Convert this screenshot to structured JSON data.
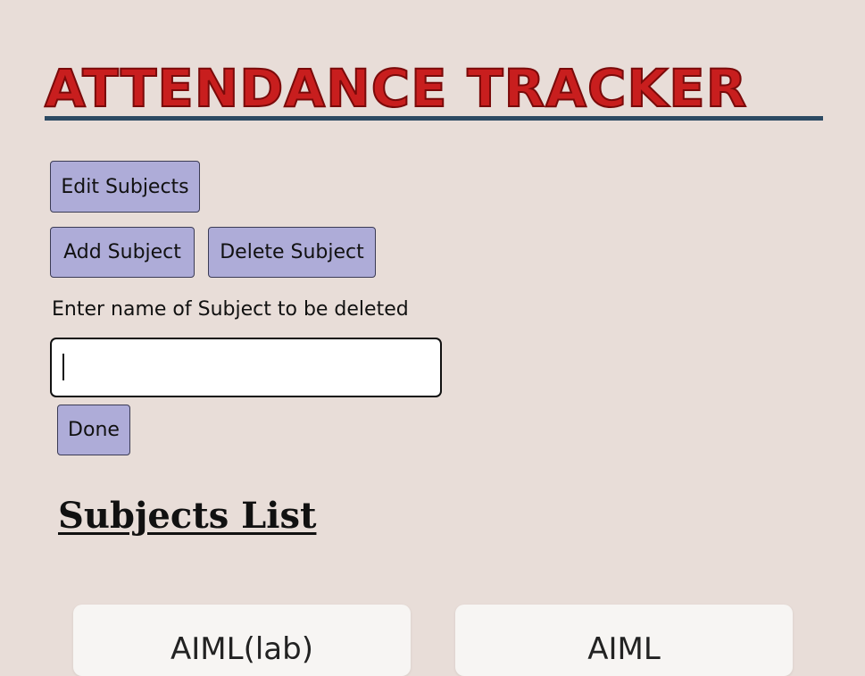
{
  "app": {
    "title": "ATTENDANCE TRACKER"
  },
  "controls": {
    "edit_subjects_label": "Edit Subjects",
    "add_subject_label": "Add Subject",
    "delete_subject_label": "Delete Subject"
  },
  "delete_form": {
    "prompt": "Enter name of Subject to be deleted",
    "input_value": "",
    "done_label": "Done"
  },
  "subjects": {
    "heading": "Subjects List",
    "items": [
      {
        "name": "AIML(lab)"
      },
      {
        "name": "AIML"
      }
    ]
  },
  "colors": {
    "background": "#e8ddd8",
    "title_red": "#c81e1e",
    "title_rule": "#2c4a63",
    "button_fill": "#aeacd8",
    "card_fill": "#f7f5f3"
  }
}
